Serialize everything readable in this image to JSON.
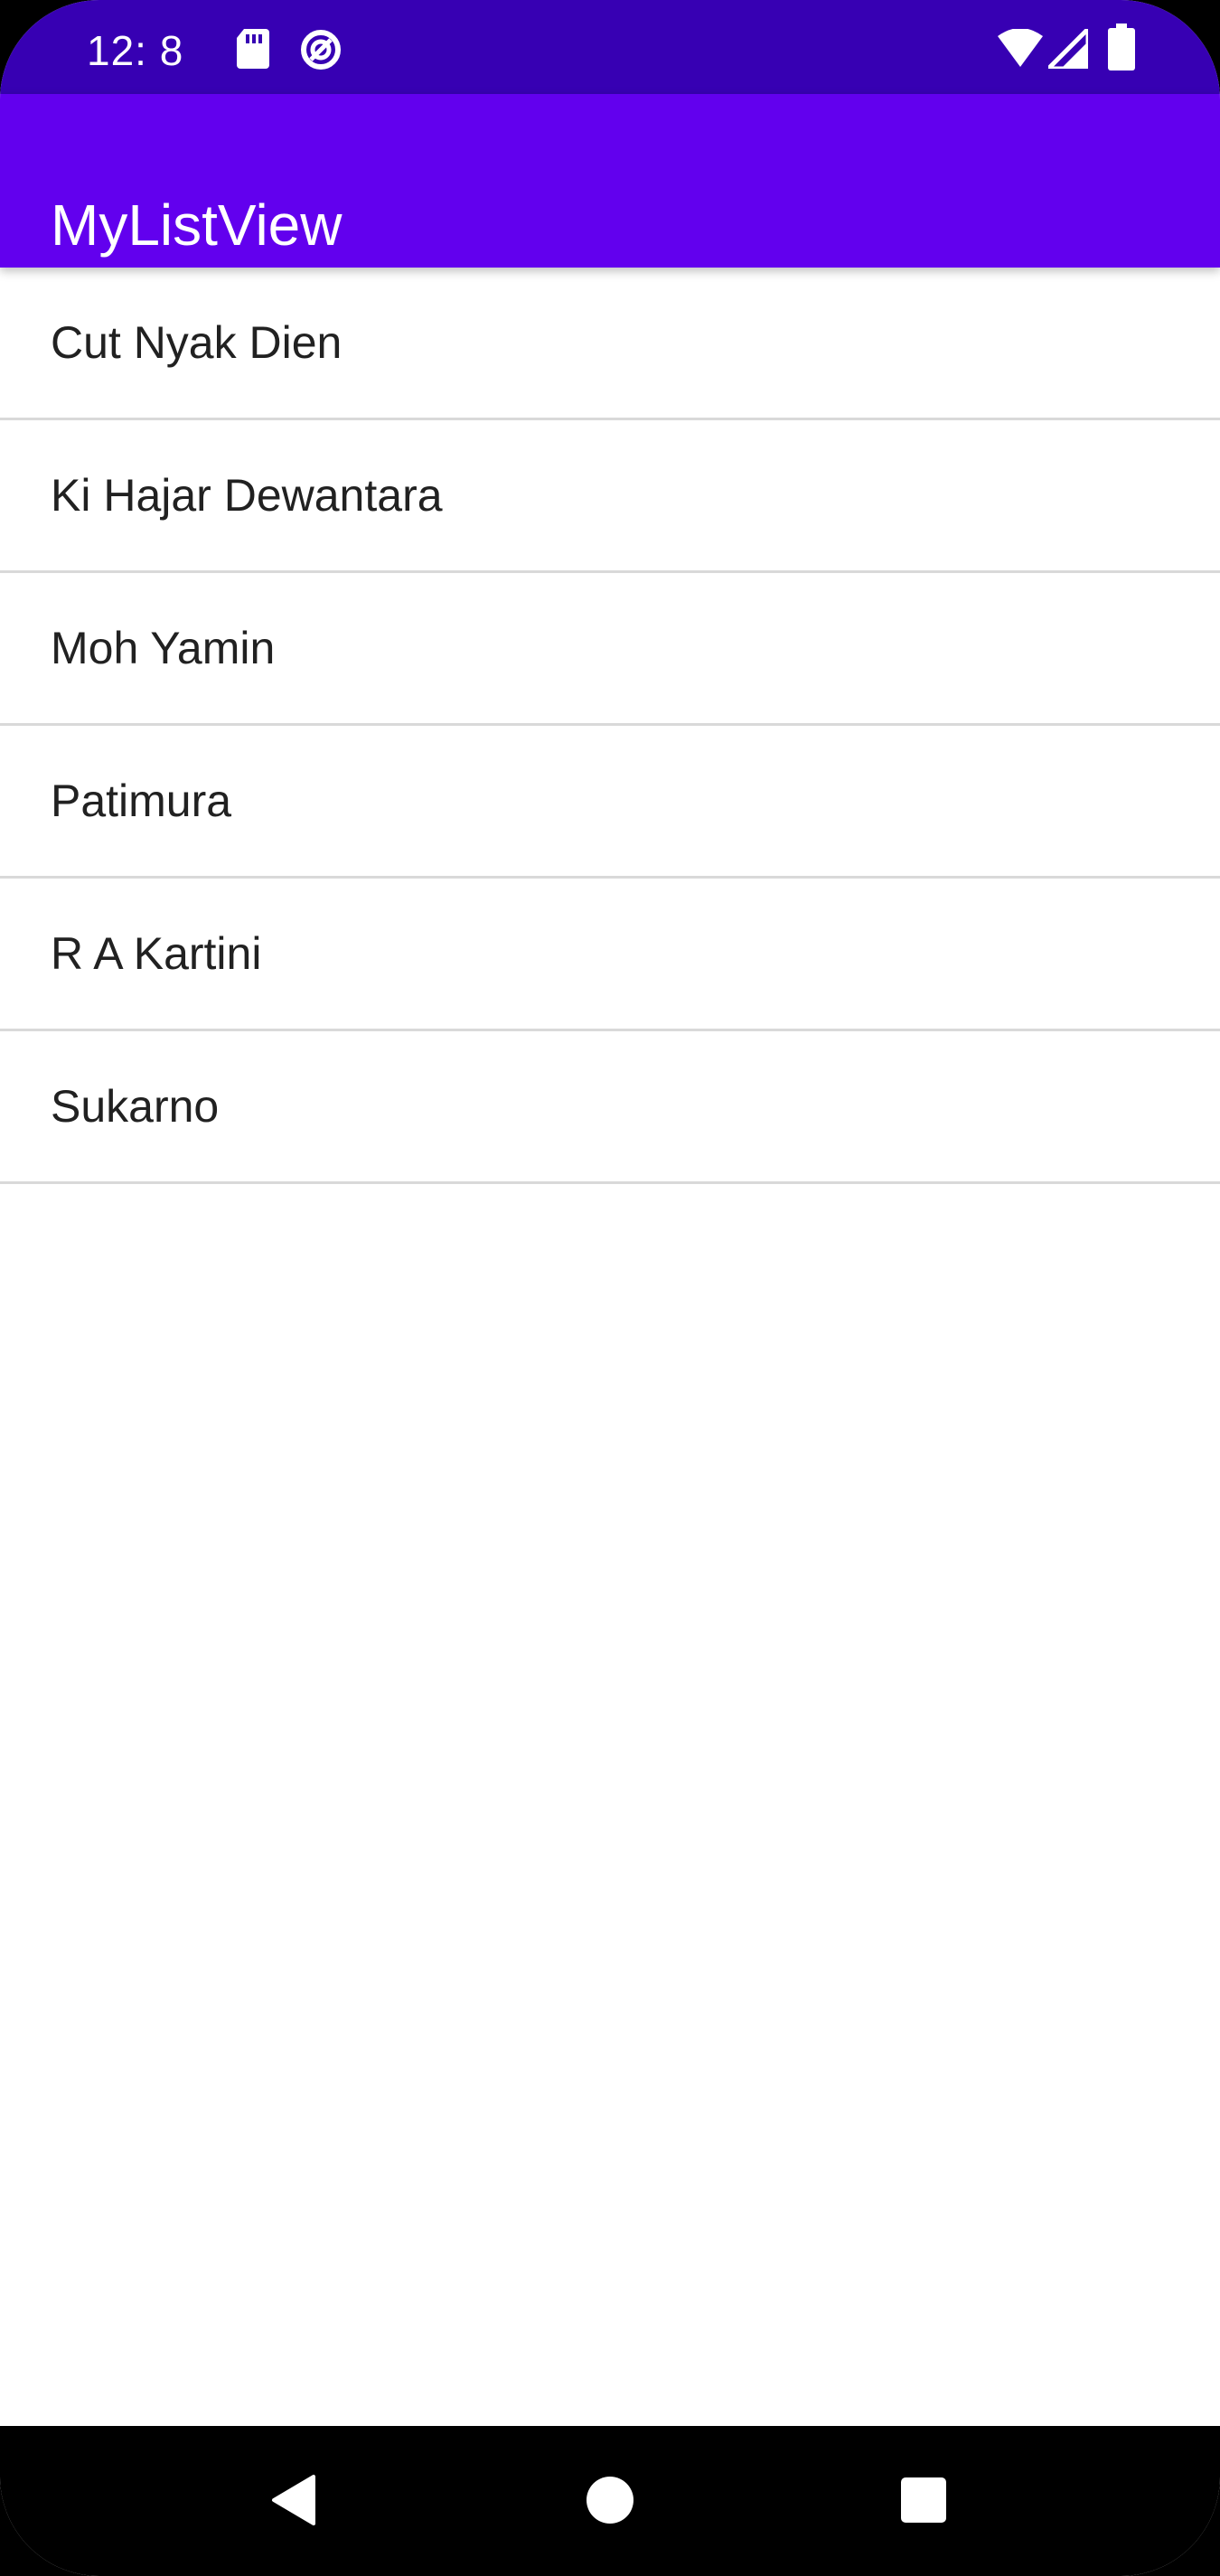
{
  "status_bar": {
    "time": "12:  8",
    "left_icons": [
      "sd-card-icon",
      "data-saver-icon"
    ],
    "right_icons": [
      "wifi-icon",
      "cellular-signal-icon",
      "battery-icon"
    ]
  },
  "app_bar": {
    "title": "MyListView",
    "color": "#6200EE"
  },
  "list": {
    "items": [
      {
        "label": "Cut Nyak Dien"
      },
      {
        "label": "Ki Hajar Dewantara"
      },
      {
        "label": "Moh Yamin"
      },
      {
        "label": "Patimura"
      },
      {
        "label": "R A Kartini"
      },
      {
        "label": "Sukarno"
      }
    ]
  },
  "nav_bar": {
    "buttons": [
      "back-icon",
      "home-icon",
      "recents-icon"
    ]
  },
  "colors": {
    "status_bar": "#3700B3",
    "app_bar": "#6200EE",
    "divider": "#d9d9d9",
    "text": "#212121"
  }
}
